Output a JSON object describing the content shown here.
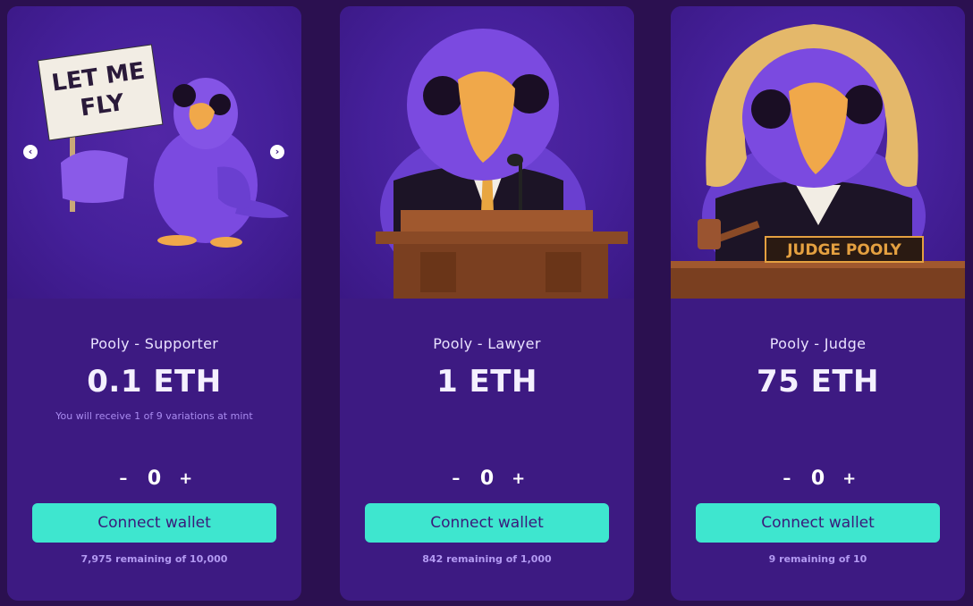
{
  "cards": [
    {
      "name": "Pooly - Supporter",
      "price": "0.1 ETH",
      "note": "You will receive 1 of 9 variations at mint",
      "sign_text": "LET ME FLY",
      "quantity": "0",
      "minus": "–",
      "plus": "+",
      "button": "Connect wallet",
      "remaining": "7,975 remaining of 10,000",
      "prev_arrow": "‹",
      "next_arrow": "›"
    },
    {
      "name": "Pooly - Lawyer",
      "price": "1 ETH",
      "quantity": "0",
      "minus": "–",
      "plus": "+",
      "button": "Connect wallet",
      "remaining": "842 remaining of 1,000"
    },
    {
      "name": "Pooly - Judge",
      "price": "75 ETH",
      "nameplate": "JUDGE POOLY",
      "quantity": "0",
      "minus": "–",
      "plus": "+",
      "button": "Connect wallet",
      "remaining": "9 remaining of 10"
    }
  ],
  "colors": {
    "background": "#2b1050",
    "card": "#3d1a82",
    "accent_button": "#3ee6cf",
    "bird": "#7b4ae0",
    "beak": "#f0a84a"
  }
}
